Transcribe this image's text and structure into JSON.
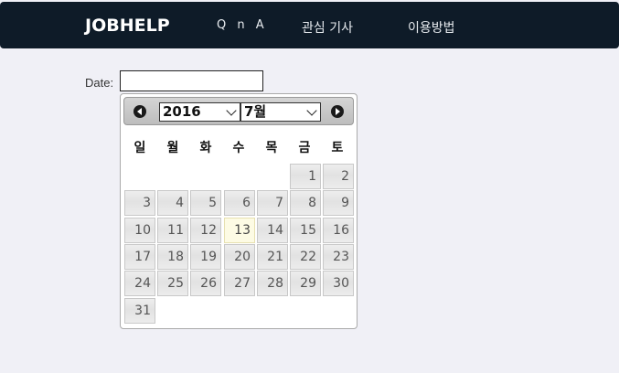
{
  "navbar": {
    "brand": "JOBHELP",
    "links": [
      "Q n A",
      "관심 기사",
      "이용방법"
    ]
  },
  "form": {
    "date_label": "Date:",
    "date_value": ""
  },
  "datepicker": {
    "year": "2016",
    "month": "7월",
    "weekdays": [
      "일",
      "월",
      "화",
      "수",
      "목",
      "금",
      "토"
    ],
    "first_weekday_index": 5,
    "days": [
      "1",
      "2",
      "3",
      "4",
      "5",
      "6",
      "7",
      "8",
      "9",
      "10",
      "11",
      "12",
      "13",
      "14",
      "15",
      "16",
      "17",
      "18",
      "19",
      "20",
      "21",
      "22",
      "23",
      "24",
      "25",
      "26",
      "27",
      "28",
      "29",
      "30",
      "31"
    ],
    "today": "13"
  }
}
